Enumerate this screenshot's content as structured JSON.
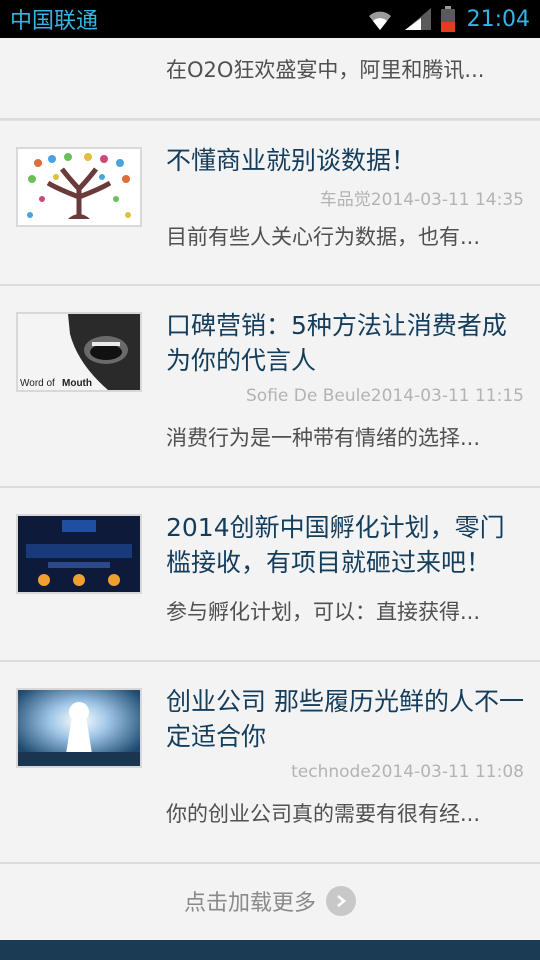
{
  "status_bar": {
    "carrier": "中国联通",
    "time": "21:04"
  },
  "articles": [
    {
      "title": "",
      "meta": "",
      "summary": "在O2O狂欢盛宴中，阿里和腾讯..."
    },
    {
      "title": "不懂商业就别谈数据！",
      "meta": "车品觉2014-03-11 14:35",
      "summary": "目前有些人关心行为数据，也有...",
      "thumb_icon": "data-tree-icon"
    },
    {
      "title": "口碑营销：5种方法让消费者成为你的代言人",
      "meta": "Sofie De Beule2014-03-11 11:15",
      "summary": "消费行为是一种带有情绪的选择...",
      "thumb_icon": "word-of-mouth-image",
      "thumb_caption_a": "Word of ",
      "thumb_caption_b": "Mouth"
    },
    {
      "title": "2014创新中国孵化计划，零门槛接收，有项目就砸过来吧！",
      "meta": "",
      "summary": "参与孵化计划，可以：直接获得...",
      "thumb_icon": "incubation-banner-image"
    },
    {
      "title": "创业公司 那些履历光鲜的人不一定适合你",
      "meta": "technode2014-03-11 11:08",
      "summary": "你的创业公司真的需要有很有经...",
      "thumb_icon": "keyhole-image"
    }
  ],
  "load_more": {
    "label": "点击加载更多"
  },
  "colors": {
    "status_accent": "#33b5e5",
    "title": "#143d5c",
    "bottom_bar": "#1b3b54"
  }
}
